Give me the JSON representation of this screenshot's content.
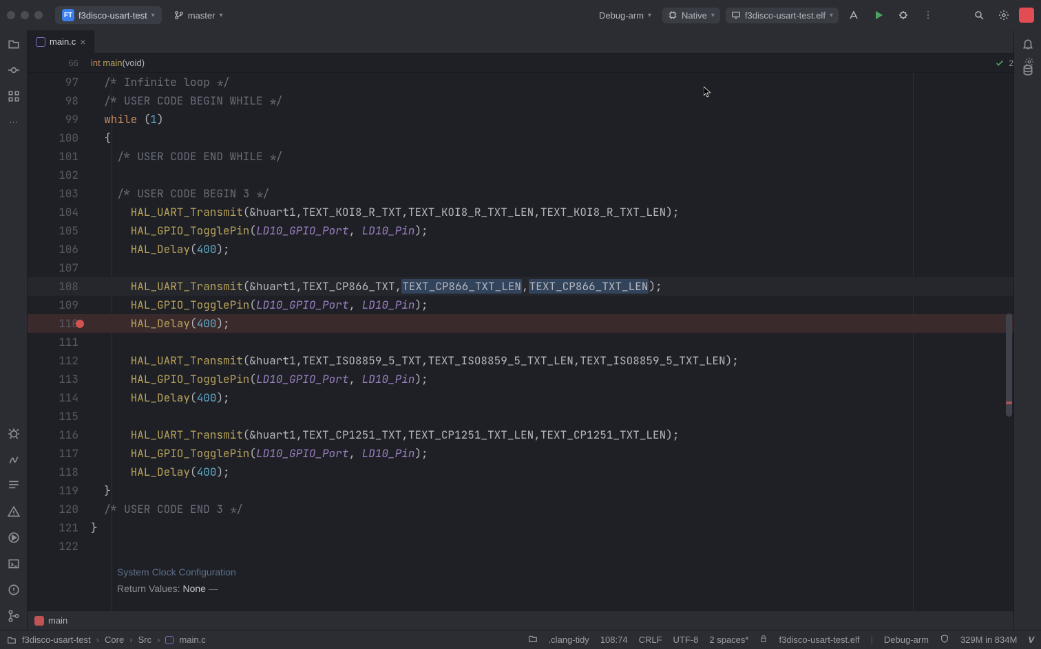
{
  "titlebar": {
    "project_badge": "FT",
    "project_name": "f3disco-usart-test",
    "branch": "master",
    "run_config": "Debug-arm",
    "target": "Native",
    "target_exe": "f3disco-usart-test.elf"
  },
  "tab": {
    "filename": "main.c"
  },
  "sticky": {
    "line_no": "66",
    "fn_prefix": "int ",
    "fn_name": "main",
    "fn_args": "(void)",
    "problem_count": "2"
  },
  "chart_data": null,
  "lines": [
    {
      "no": "97",
      "indent": 1,
      "segs": [
        {
          "c": "com",
          "t": "/* Infinite loop */"
        }
      ]
    },
    {
      "no": "98",
      "indent": 1,
      "segs": [
        {
          "c": "com",
          "t": "/* USER CODE BEGIN WHILE */"
        }
      ]
    },
    {
      "no": "99",
      "indent": 1,
      "segs": [
        {
          "c": "kw",
          "t": "while"
        },
        {
          "c": "paren",
          "t": " ("
        },
        {
          "c": "num",
          "t": "1"
        },
        {
          "c": "paren",
          "t": ")"
        }
      ]
    },
    {
      "no": "100",
      "indent": 1,
      "segs": [
        {
          "c": "paren",
          "t": "{"
        }
      ]
    },
    {
      "no": "101",
      "indent": 2,
      "segs": [
        {
          "c": "com",
          "t": "/* USER CODE END WHILE */"
        }
      ]
    },
    {
      "no": "102",
      "indent": 2,
      "segs": []
    },
    {
      "no": "103",
      "indent": 2,
      "segs": [
        {
          "c": "com",
          "t": "/* USER CODE BEGIN 3 */"
        }
      ]
    },
    {
      "no": "104",
      "indent": 3,
      "segs": [
        {
          "c": "fn",
          "t": "HAL_UART_Transmit"
        },
        {
          "c": "paren",
          "t": "(&huart1,TEXT_KOI8_R_TXT,TEXT_KOI8_R_TXT_LEN,TEXT_KOI8_R_TXT_LEN);"
        }
      ]
    },
    {
      "no": "105",
      "indent": 3,
      "segs": [
        {
          "c": "fn",
          "t": "HAL_GPIO_TogglePin"
        },
        {
          "c": "paren",
          "t": "("
        },
        {
          "c": "mac",
          "t": "LD10_GPIO_Port"
        },
        {
          "c": "paren",
          "t": ", "
        },
        {
          "c": "mac",
          "t": "LD10_Pin"
        },
        {
          "c": "paren",
          "t": ");"
        }
      ]
    },
    {
      "no": "106",
      "indent": 3,
      "segs": [
        {
          "c": "fn",
          "t": "HAL_Delay"
        },
        {
          "c": "paren",
          "t": "("
        },
        {
          "c": "num",
          "t": "400"
        },
        {
          "c": "paren",
          "t": ");"
        }
      ]
    },
    {
      "no": "107",
      "indent": 3,
      "segs": []
    },
    {
      "no": "108",
      "cur": true,
      "indent": 3,
      "segs": [
        {
          "c": "fn",
          "t": "HAL_UART_Transmit"
        },
        {
          "c": "paren",
          "t": "(&huart1,TEXT_CP866_TXT,"
        },
        {
          "c": "paren",
          "t": "TEXT_CP866_TXT_LEN",
          "sel": true
        },
        {
          "c": "paren",
          "t": ","
        },
        {
          "c": "paren",
          "t": "TEXT_CP866_TXT_LEN",
          "sel": true
        },
        {
          "c": "paren",
          "t": ");"
        }
      ]
    },
    {
      "no": "109",
      "indent": 3,
      "segs": [
        {
          "c": "fn",
          "t": "HAL_GPIO_TogglePin"
        },
        {
          "c": "paren",
          "t": "("
        },
        {
          "c": "mac",
          "t": "LD10_GPIO_Port"
        },
        {
          "c": "paren",
          "t": ", "
        },
        {
          "c": "mac",
          "t": "LD10_Pin"
        },
        {
          "c": "paren",
          "t": ");"
        }
      ]
    },
    {
      "no": "110",
      "bp": true,
      "indent": 3,
      "segs": [
        {
          "c": "fn",
          "t": "HAL_Delay"
        },
        {
          "c": "paren",
          "t": "("
        },
        {
          "c": "num",
          "t": "400"
        },
        {
          "c": "paren",
          "t": ");"
        }
      ]
    },
    {
      "no": "111",
      "indent": 3,
      "segs": []
    },
    {
      "no": "112",
      "indent": 3,
      "segs": [
        {
          "c": "fn",
          "t": "HAL_UART_Transmit"
        },
        {
          "c": "paren",
          "t": "(&huart1,TEXT_ISO8859_5_TXT,TEXT_ISO8859_5_TXT_LEN,TEXT_ISO8859_5_TXT_LEN);"
        }
      ]
    },
    {
      "no": "113",
      "indent": 3,
      "segs": [
        {
          "c": "fn",
          "t": "HAL_GPIO_TogglePin"
        },
        {
          "c": "paren",
          "t": "("
        },
        {
          "c": "mac",
          "t": "LD10_GPIO_Port"
        },
        {
          "c": "paren",
          "t": ", "
        },
        {
          "c": "mac",
          "t": "LD10_Pin"
        },
        {
          "c": "paren",
          "t": ");"
        }
      ]
    },
    {
      "no": "114",
      "indent": 3,
      "segs": [
        {
          "c": "fn",
          "t": "HAL_Delay"
        },
        {
          "c": "paren",
          "t": "("
        },
        {
          "c": "num",
          "t": "400"
        },
        {
          "c": "paren",
          "t": ");"
        }
      ]
    },
    {
      "no": "115",
      "indent": 3,
      "segs": []
    },
    {
      "no": "116",
      "indent": 3,
      "segs": [
        {
          "c": "fn",
          "t": "HAL_UART_Transmit"
        },
        {
          "c": "paren",
          "t": "(&huart1,TEXT_CP1251_TXT,TEXT_CP1251_TXT_LEN,TEXT_CP1251_TXT_LEN);"
        }
      ]
    },
    {
      "no": "117",
      "indent": 3,
      "segs": [
        {
          "c": "fn",
          "t": "HAL_GPIO_TogglePin"
        },
        {
          "c": "paren",
          "t": "("
        },
        {
          "c": "mac",
          "t": "LD10_GPIO_Port"
        },
        {
          "c": "paren",
          "t": ", "
        },
        {
          "c": "mac",
          "t": "LD10_Pin"
        },
        {
          "c": "paren",
          "t": ");"
        }
      ]
    },
    {
      "no": "118",
      "indent": 3,
      "segs": [
        {
          "c": "fn",
          "t": "HAL_Delay"
        },
        {
          "c": "paren",
          "t": "("
        },
        {
          "c": "num",
          "t": "400"
        },
        {
          "c": "paren",
          "t": ");"
        }
      ]
    },
    {
      "no": "119",
      "indent": 1,
      "segs": [
        {
          "c": "paren",
          "t": "}"
        }
      ]
    },
    {
      "no": "120",
      "indent": 1,
      "segs": [
        {
          "c": "com",
          "t": "/* USER CODE END 3 */"
        }
      ]
    },
    {
      "no": "121",
      "indent": 0,
      "segs": [
        {
          "c": "paren",
          "t": "}"
        }
      ]
    },
    {
      "no": "122",
      "indent": 0,
      "segs": []
    }
  ],
  "doc": {
    "title": "System Clock Configuration",
    "return_label": "Return Values:",
    "return_val": "None",
    "dash": " —"
  },
  "crumb": {
    "fn": "main"
  },
  "breadcrumbs": [
    "f3disco-usart-test",
    "Core",
    "Src",
    "main.c"
  ],
  "status": {
    "clang": ".clang-tidy",
    "pos": "108:74",
    "eol": "CRLF",
    "enc": "UTF-8",
    "indent": "2 spaces*",
    "target": "f3disco-usart-test.elf",
    "config": "Debug-arm",
    "mem": "329M in 834M"
  }
}
